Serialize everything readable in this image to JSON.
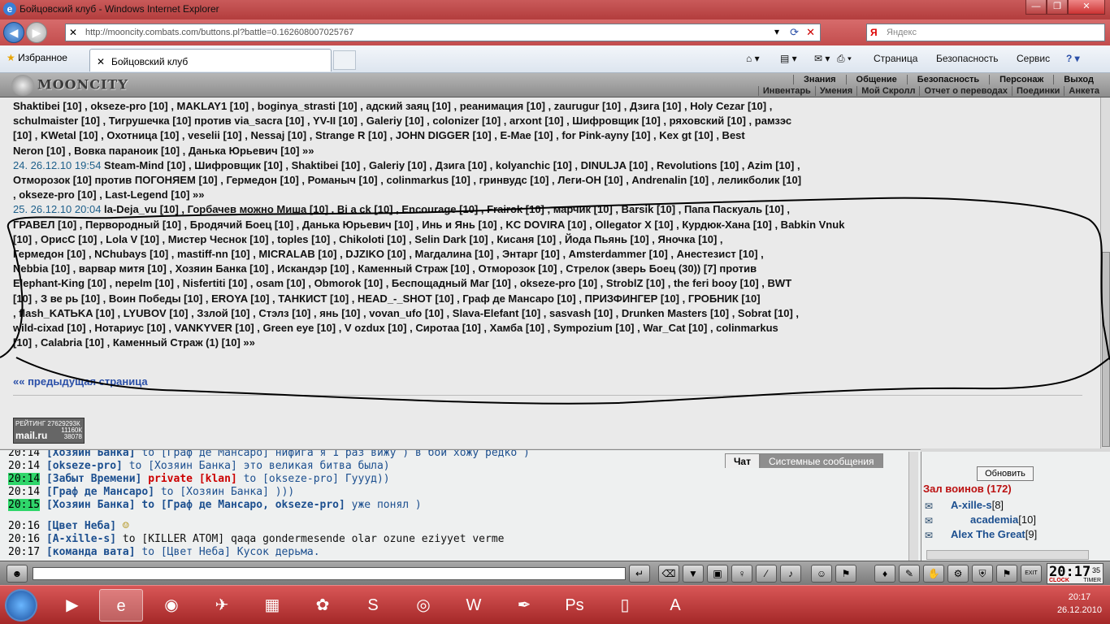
{
  "window": {
    "title": "Бойцовский клуб - Windows Internet Explorer",
    "buttons": [
      "—",
      "❐",
      "✕"
    ]
  },
  "address": {
    "url": "http://mooncity.combats.com/buttons.pl?battle=0.162608007025767",
    "search_placeholder": "Яндекс"
  },
  "favorites": {
    "label": "Избранное",
    "tab_title": "Бойцовский клуб"
  },
  "commands": [
    "Страница",
    "Безопасность",
    "Сервис"
  ],
  "game": {
    "logo": "MOONCITY",
    "menu_top": [
      "Знания",
      "Общение",
      "Безопасность",
      "Персонаж",
      "Выход"
    ],
    "menu_bottom": [
      "Инвентарь",
      "Умения",
      "Мой Скролл",
      "Отчет о переводах",
      "Поединки",
      "Анкета"
    ]
  },
  "log": {
    "prev_page": "«« предыдущая страница",
    "lines": [
      "Shaktibei [10] , okseze-pro [10] , MAKLAY1 [10] , boginya_strasti [10] , адский заяц [10] , реанимация [10] , zaurugur [10] , Дзига [10] , Holy Cezar [10] ,",
      "schulmaister [10] , Тигрушечка [10] против via_sacra [10] , YV-II [10] , Galeriy [10] , colonizer [10] , arxont [10] , Шифровщик [10] , ряховский [10] , рамзэс",
      "[10] , KWetal [10] , Охотница [10] , veselii [10] , Nessaj [10] , Strange R [10] , JOHN DIGGER [10] , E-Mae [10] , for Pink-ayny [10] , Kex gt [10] , Best",
      "Neron [10] , Вовка параноик [10] , Данька Юрьевич [10] »»"
    ],
    "turn24_ts": "24. 26.12.10 19:54",
    "turn24": [
      " Steam-Mind [10] , Шифровщик [10] , Shaktibei [10] , Galeriy [10] , Дзига [10] , kolyanchic [10] , DINULJA [10] , Revolutions [10] , Azim [10] ,",
      "Отморозок [10] против ПОГОНЯЕМ [10] , Гермедон [10] , Романыч [10] , colinmarkus [10] , гринвудс [10] , Леги-ОН [10] , Andrenalin [10] , леликболик [10]",
      ", okseze-pro [10] , Last-Legend [10] »»"
    ],
    "turn25_ts": "25. 26.12.10 20:04",
    "turn25": [
      " la-Deja_vu [10] , Горбачев можно Миша [10] , Bi a ck [10] , Encourage [10] , Frairok [10] , марчик [10] , Barsik [10] , Папа Паскуаль [10] ,",
      "ГРАВЕЛ [10] , Первородный [10] , Бродячий Боец [10] , Данька Юрьевич [10] , Инь и Янь [10] , KC DOVIRA [10] , Ollegator X [10] , Курдюк-Хана [10] , Babkin Vnuk",
      "[10] , ОрисС [10] , Lola V [10] , Мистер Чеснок [10] , toples [10] , Chikoloti [10] , Selin Dark [10] , Кисаня [10] , Йода Пьянь [10] , Яночка [10] ,",
      "Гермедон [10] , NChubays [10] , mastiff-nn [10] , MICRALAB [10] , DJZIKO [10] , Магдалина [10] , Энтарг [10] , Amsterdammer [10] , Анестезист [10] ,",
      "Nebbia [10] , варвар митя [10] , Хозяин Банка [10] , Искандэр [10] , Каменный Страж [10] , Отморозок [10] , Стрелок (зверь Боец (30)) [7] против",
      "Elephant-King [10] , nepelm [10] , Nisfertiti [10] , osam [10] , Obmorok [10] , Беспощадный Маг [10] , okseze-pro [10] , StroblZ [10] , the feri booy [10] , BWT",
      "[10] , З ве рь [10] , Воин Победы [10] , EROYA [10] , ТАНКИСТ [10] , HEAD_-_SHOT [10] , Граф де Мансаро [10] , ПРИЗФИНГЕР [10] , ГРОБНИК [10]",
      ", flash_KATЬKA [10] , LYUBOV [10] , Ззлой [10] , Стэлз [10] , янь [10] , vovan_ufo [10] , Slava-Elefant [10] , sasvash [10] , Drunken Masters [10] , Sobrat [10] ,",
      "wild-cixad [10] , Нотариус [10] , VANKYVER [10] , Green eye [10] , V ozdux [10] , Сиротаа [10] , Хамба [10] , Sympozium [10] , War_Cat [10] , colinmarkus",
      "[10] , Calabria [10] , Каменный Страж (1) [10] »»"
    ]
  },
  "rating": {
    "label": "РЕЙТИНГ 27629293К",
    "brand": "mail.ru",
    "n1": "11160К",
    "n2": "38078"
  },
  "chat": {
    "tabs": [
      "Чат",
      "Системные сообщения"
    ],
    "lines": [
      {
        "time": "20:14",
        "nick": "[Хозяин Банка]",
        "text": " to [Граф де Мансаро] нифига я 1 раз вижу ) в бой хожу редко )",
        "hl": false
      },
      {
        "time": "20:14",
        "nick": "[okseze-pro]",
        "text": " to [Хозяин Банка] это великая битва была)",
        "hl": false
      },
      {
        "time": "20:14",
        "nick": "[Забыт Времени]",
        "priv": " private [klan]",
        "text": " to [okseze-pro] Гуууд))",
        "hl": true
      },
      {
        "time": "20:14",
        "nick": "[Граф де Мансаро]",
        "text": " to [Хозяин Банка] )))",
        "hl": false
      },
      {
        "time": "20:15",
        "nick": "[Хозяин Банка]",
        "bold": " to [Граф де Мансаро, okseze-pro]",
        "text": " уже понял )",
        "hl": true
      },
      {
        "time": "20:16",
        "nick": "[Цвет Неба]",
        "text": "",
        "hl": false
      },
      {
        "time": "20:16",
        "nick": "[A-xille-s]",
        "text": " to [KILLER ATOM] qaqa gondermesende olar ozune eziyyet verme",
        "hl": false
      },
      {
        "time": "20:17",
        "nick": "[команда вата]",
        "text": " to [Цвет Неба] Кусок дерьма.",
        "hl": false
      }
    ]
  },
  "users": {
    "refresh": "Обновить",
    "hall": "Зал воинов (172)",
    "list": [
      {
        "name": "A-xille-s",
        "level": "[8]"
      },
      {
        "name": "academia",
        "level": "[10]"
      },
      {
        "name": "Alex The Great",
        "level": "[9]"
      }
    ]
  },
  "clock": {
    "time": "20:17",
    "sec": "35",
    "clock_label": "CLOCK",
    "timer_label": "TIMER"
  },
  "exit_label": "EXIT",
  "tray": {
    "time": "20:17",
    "date": "26.12.2010"
  }
}
